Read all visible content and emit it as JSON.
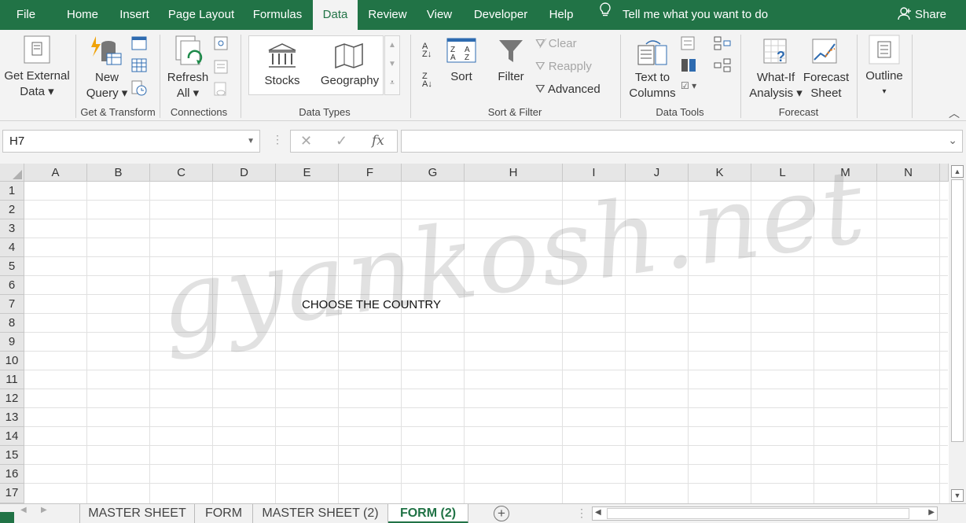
{
  "tabs": [
    "File",
    "Home",
    "Insert",
    "Page Layout",
    "Formulas",
    "Data",
    "Review",
    "View",
    "Developer",
    "Help"
  ],
  "active_tab": "Data",
  "tell_me": "Tell me what you want to do",
  "share": "Share",
  "ribbon": {
    "get_external_1": "Get External",
    "get_external_2": "Data",
    "new_query_1": "New",
    "new_query_2": "Query",
    "refresh_1": "Refresh",
    "refresh_2": "All",
    "stocks": "Stocks",
    "geography": "Geography",
    "sort": "Sort",
    "filter": "Filter",
    "clear": "Clear",
    "reapply": "Reapply",
    "advanced": "Advanced",
    "text_to_columns_1": "Text to",
    "text_to_columns_2": "Columns",
    "whatif_1": "What-If",
    "whatif_2": "Analysis",
    "forecast_1": "Forecast",
    "forecast_2": "Sheet",
    "outline": "Outline",
    "groups": {
      "get_transform": "Get & Transform",
      "connections": "Connections",
      "data_types": "Data Types",
      "sort_filter": "Sort & Filter",
      "data_tools": "Data Tools",
      "forecast": "Forecast"
    }
  },
  "formula_bar": {
    "name_box": "H7",
    "fx": "fx",
    "value": ""
  },
  "columns": [
    "A",
    "B",
    "C",
    "D",
    "E",
    "F",
    "G",
    "H",
    "I",
    "J",
    "K",
    "L",
    "M",
    "N"
  ],
  "rows": [
    "1",
    "2",
    "3",
    "4",
    "5",
    "6",
    "7",
    "8",
    "9",
    "10",
    "11",
    "12",
    "13",
    "14",
    "15",
    "16",
    "17"
  ],
  "cells": {
    "E7": "CHOOSE THE COUNTRY"
  },
  "watermark": "gyankosh.net",
  "sheets": [
    "MASTER SHEET",
    "FORM",
    "MASTER SHEET (2)",
    "FORM (2)"
  ],
  "active_sheet": "FORM (2)",
  "colors": {
    "accent": "#217346"
  }
}
